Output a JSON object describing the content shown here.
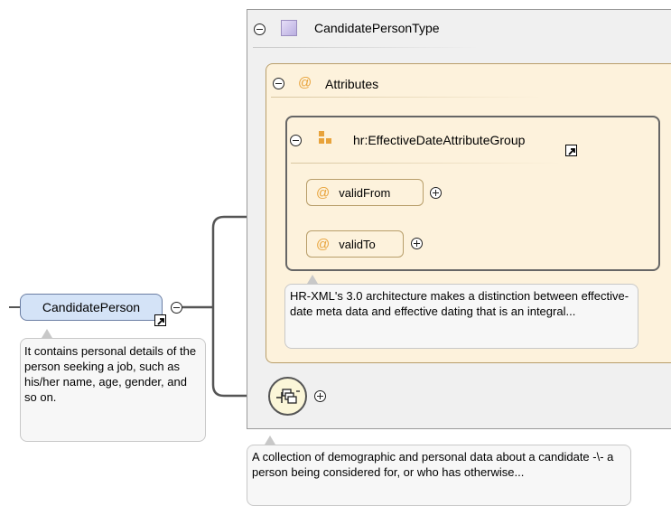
{
  "complex_type": {
    "label": "CandidatePersonType"
  },
  "attributes": {
    "label": "Attributes"
  },
  "attribute_group": {
    "label": "hr:EffectiveDateAttributeGroup"
  },
  "attrs": [
    {
      "label": "validFrom"
    },
    {
      "label": "validTo"
    }
  ],
  "attribute_group_note": "HR-XML's 3.0 architecture makes a distinction between effective-date meta data and effective dating that is an integral...",
  "element": {
    "label": "CandidatePerson"
  },
  "element_note": "It contains personal details of the person seeking a job, such as his/her name, age, gender, and so on.",
  "type_note": "A collection of demographic and personal data about a candidate -\\- a person being considered for, or who has otherwise...",
  "at_symbol": "@",
  "colors": {
    "type_panel_bg": "#f0f0f0",
    "attributes_bg": "#fdf2dc",
    "element_bg": "#d4e3f7",
    "accent_orange": "#e8a33b",
    "connector": "#555555"
  },
  "icons": {
    "type": "complex-type-icon",
    "attribute": "at-sign-icon",
    "group": "attribute-group-icon",
    "sequence": "sequence-compositor-icon",
    "jump": "jump-arrow-icon"
  }
}
